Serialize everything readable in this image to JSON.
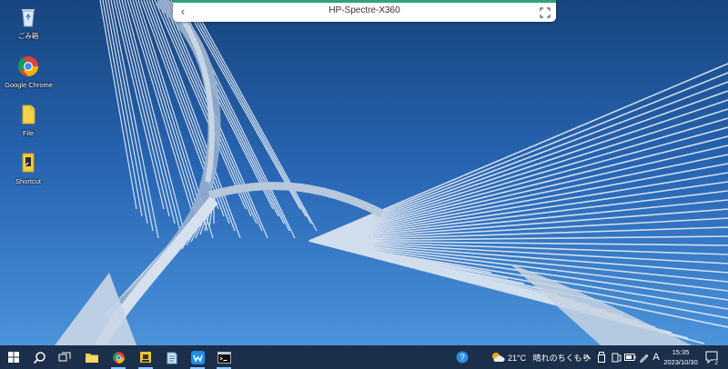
{
  "remote_session": {
    "title": "HP-Spectre-X360",
    "back_icon": "chevron-left-icon",
    "fullscreen_icon": "fullscreen-icon"
  },
  "desktop": {
    "wallpaper": "bridge-cables-blue-sky",
    "icons": [
      {
        "label": "ごみ箱",
        "icon": "recycle-bin-icon"
      },
      {
        "label": "Google Chrome",
        "icon": "chrome-icon"
      },
      {
        "label": "File",
        "icon": "file-icon"
      },
      {
        "label": "Shortcut",
        "icon": "shortcut-icon"
      }
    ]
  },
  "taskbar": {
    "apps": [
      {
        "name": "start",
        "icon": "windows-start-icon"
      },
      {
        "name": "search",
        "icon": "search-icon"
      },
      {
        "name": "task-view",
        "icon": "task-view-icon"
      },
      {
        "name": "file-explorer",
        "icon": "folder-icon"
      },
      {
        "name": "chrome",
        "icon": "chrome-icon"
      },
      {
        "name": "app-yellow",
        "icon": "yellow-app-icon"
      },
      {
        "name": "notepad",
        "icon": "notepad-icon"
      },
      {
        "name": "app-blue",
        "icon": "blue-app-icon"
      },
      {
        "name": "terminal",
        "icon": "terminal-icon"
      }
    ],
    "weather": {
      "temp": "21°C",
      "condition": "晴れのちくもり",
      "icon": "weather-sun-cloud-icon"
    },
    "tray": {
      "help_icon": "help-icon",
      "ime": "A",
      "time": "15:35",
      "date": "2023/10/30",
      "notifications_count": "2"
    },
    "colors": {
      "taskbar": "#1b2e4a",
      "accent": "#2fa37a"
    }
  }
}
